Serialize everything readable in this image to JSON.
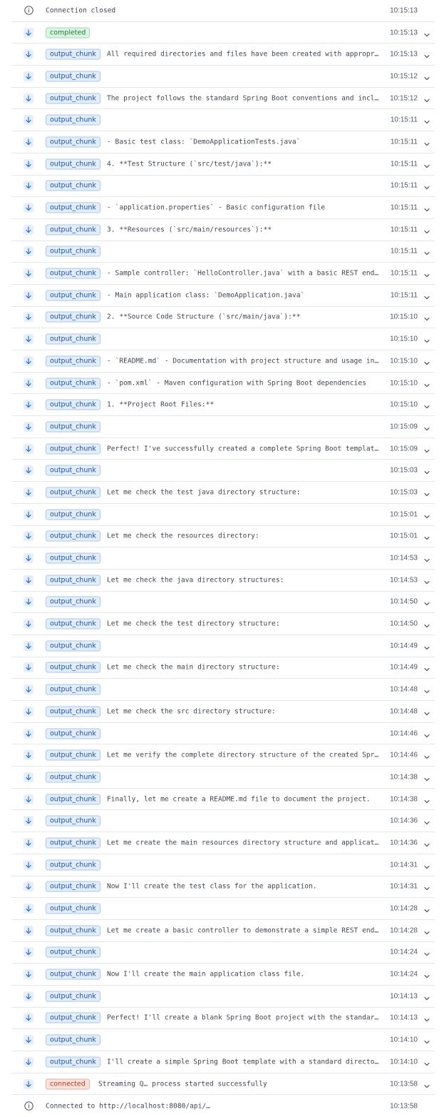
{
  "log": {
    "rows": [
      {
        "kind": "info",
        "badge": "",
        "badge_color": "",
        "message": "Connection closed",
        "time": "10:15:13",
        "expandable": false
      },
      {
        "kind": "event",
        "badge": "completed",
        "badge_color": "green",
        "message": "",
        "time": "10:15:13",
        "expandable": true
      },
      {
        "kind": "event",
        "badge": "output_chunk",
        "badge_color": "blue",
        "message": "All required directories and files have been created with appropriate …",
        "time": "10:15:13",
        "expandable": true
      },
      {
        "kind": "event",
        "badge": "output_chunk",
        "badge_color": "blue",
        "message": "",
        "time": "10:15:12",
        "expandable": true
      },
      {
        "kind": "event",
        "badge": "output_chunk",
        "badge_color": "blue",
        "message": "The project follows the standard Spring Boot conventions and includes …",
        "time": "10:15:12",
        "expandable": true
      },
      {
        "kind": "event",
        "badge": "output_chunk",
        "badge_color": "blue",
        "message": "",
        "time": "10:15:11",
        "expandable": true
      },
      {
        "kind": "event",
        "badge": "output_chunk",
        "badge_color": "blue",
        "message": "- Basic test class: `DemoApplicationTests.java`",
        "time": "10:15:11",
        "expandable": true
      },
      {
        "kind": "event",
        "badge": "output_chunk",
        "badge_color": "blue",
        "message": "4. **Test Structure (`src/test/java`):**",
        "time": "10:15:11",
        "expandable": true
      },
      {
        "kind": "event",
        "badge": "output_chunk",
        "badge_color": "blue",
        "message": "",
        "time": "10:15:11",
        "expandable": true
      },
      {
        "kind": "event",
        "badge": "output_chunk",
        "badge_color": "blue",
        "message": "- `application.properties` - Basic configuration file",
        "time": "10:15:11",
        "expandable": true
      },
      {
        "kind": "event",
        "badge": "output_chunk",
        "badge_color": "blue",
        "message": "3. **Resources (`src/main/resources`):**",
        "time": "10:15:11",
        "expandable": true
      },
      {
        "kind": "event",
        "badge": "output_chunk",
        "badge_color": "blue",
        "message": "",
        "time": "10:15:11",
        "expandable": true
      },
      {
        "kind": "event",
        "badge": "output_chunk",
        "badge_color": "blue",
        "message": "- Sample controller: `HelloController.java` with a basic REST endpoint",
        "time": "10:15:11",
        "expandable": true
      },
      {
        "kind": "event",
        "badge": "output_chunk",
        "badge_color": "blue",
        "message": "- Main application class: `DemoApplication.java`",
        "time": "10:15:11",
        "expandable": true
      },
      {
        "kind": "event",
        "badge": "output_chunk",
        "badge_color": "blue",
        "message": "2. **Source Code Structure (`src/main/java`):**",
        "time": "10:15:10",
        "expandable": true
      },
      {
        "kind": "event",
        "badge": "output_chunk",
        "badge_color": "blue",
        "message": "",
        "time": "10:15:10",
        "expandable": true
      },
      {
        "kind": "event",
        "badge": "output_chunk",
        "badge_color": "blue",
        "message": "- `README.md` - Documentation with project structure and usage instruc…",
        "time": "10:15:10",
        "expandable": true
      },
      {
        "kind": "event",
        "badge": "output_chunk",
        "badge_color": "blue",
        "message": "- `pom.xml` - Maven configuration with Spring Boot dependencies",
        "time": "10:15:10",
        "expandable": true
      },
      {
        "kind": "event",
        "badge": "output_chunk",
        "badge_color": "blue",
        "message": "1. **Project Root Files:**",
        "time": "10:15:10",
        "expandable": true
      },
      {
        "kind": "event",
        "badge": "output_chunk",
        "badge_color": "blue",
        "message": "",
        "time": "10:15:09",
        "expandable": true
      },
      {
        "kind": "event",
        "badge": "output_chunk",
        "badge_color": "blue",
        "message": "Perfect! I've successfully created a complete Spring Boot template pr…",
        "time": "10:15:09",
        "expandable": true
      },
      {
        "kind": "event",
        "badge": "output_chunk",
        "badge_color": "blue",
        "message": "",
        "time": "10:15:03",
        "expandable": true
      },
      {
        "kind": "event",
        "badge": "output_chunk",
        "badge_color": "blue",
        "message": "Let me check the test java directory structure:",
        "time": "10:15:03",
        "expandable": true
      },
      {
        "kind": "event",
        "badge": "output_chunk",
        "badge_color": "blue",
        "message": "",
        "time": "10:15:01",
        "expandable": true
      },
      {
        "kind": "event",
        "badge": "output_chunk",
        "badge_color": "blue",
        "message": "Let me check the resources directory:",
        "time": "10:15:01",
        "expandable": true
      },
      {
        "kind": "event",
        "badge": "output_chunk",
        "badge_color": "blue",
        "message": "",
        "time": "10:14:53",
        "expandable": true
      },
      {
        "kind": "event",
        "badge": "output_chunk",
        "badge_color": "blue",
        "message": "Let me check the java directory structures:",
        "time": "10:14:53",
        "expandable": true
      },
      {
        "kind": "event",
        "badge": "output_chunk",
        "badge_color": "blue",
        "message": "",
        "time": "10:14:50",
        "expandable": true
      },
      {
        "kind": "event",
        "badge": "output_chunk",
        "badge_color": "blue",
        "message": "Let me check the test directory structure:",
        "time": "10:14:50",
        "expandable": true
      },
      {
        "kind": "event",
        "badge": "output_chunk",
        "badge_color": "blue",
        "message": "",
        "time": "10:14:49",
        "expandable": true
      },
      {
        "kind": "event",
        "badge": "output_chunk",
        "badge_color": "blue",
        "message": "Let me check the main directory structure:",
        "time": "10:14:49",
        "expandable": true
      },
      {
        "kind": "event",
        "badge": "output_chunk",
        "badge_color": "blue",
        "message": "",
        "time": "10:14:48",
        "expandable": true
      },
      {
        "kind": "event",
        "badge": "output_chunk",
        "badge_color": "blue",
        "message": "Let me check the src directory structure:",
        "time": "10:14:48",
        "expandable": true
      },
      {
        "kind": "event",
        "badge": "output_chunk",
        "badge_color": "blue",
        "message": "",
        "time": "10:14:46",
        "expandable": true
      },
      {
        "kind": "event",
        "badge": "output_chunk",
        "badge_color": "blue",
        "message": "Let me verify the complete directory structure of the created Spring …",
        "time": "10:14:46",
        "expandable": true
      },
      {
        "kind": "event",
        "badge": "output_chunk",
        "badge_color": "blue",
        "message": "",
        "time": "10:14:38",
        "expandable": true
      },
      {
        "kind": "event",
        "badge": "output_chunk",
        "badge_color": "blue",
        "message": "Finally, let me create a README.md file to document the project.",
        "time": "10:14:38",
        "expandable": true
      },
      {
        "kind": "event",
        "badge": "output_chunk",
        "badge_color": "blue",
        "message": "",
        "time": "10:14:36",
        "expandable": true
      },
      {
        "kind": "event",
        "badge": "output_chunk",
        "badge_color": "blue",
        "message": "Let me create the main resources directory structure and application …",
        "time": "10:14:36",
        "expandable": true
      },
      {
        "kind": "event",
        "badge": "output_chunk",
        "badge_color": "blue",
        "message": "",
        "time": "10:14:31",
        "expandable": true
      },
      {
        "kind": "event",
        "badge": "output_chunk",
        "badge_color": "blue",
        "message": "Now I'll create the test class for the application.",
        "time": "10:14:31",
        "expandable": true
      },
      {
        "kind": "event",
        "badge": "output_chunk",
        "badge_color": "blue",
        "message": "",
        "time": "10:14:28",
        "expandable": true
      },
      {
        "kind": "event",
        "badge": "output_chunk",
        "badge_color": "blue",
        "message": "Let me create a basic controller to demonstrate a simple REST endpoin…",
        "time": "10:14:28",
        "expandable": true
      },
      {
        "kind": "event",
        "badge": "output_chunk",
        "badge_color": "blue",
        "message": "",
        "time": "10:14:24",
        "expandable": true
      },
      {
        "kind": "event",
        "badge": "output_chunk",
        "badge_color": "blue",
        "message": "Now I'll create the main application class file.",
        "time": "10:14:24",
        "expandable": true
      },
      {
        "kind": "event",
        "badge": "output_chunk",
        "badge_color": "blue",
        "message": "",
        "time": "10:14:13",
        "expandable": true
      },
      {
        "kind": "event",
        "badge": "output_chunk",
        "badge_color": "blue",
        "message": "Perfect! I'll create a blank Spring Boot project with the standard dir…",
        "time": "10:14:13",
        "expandable": true
      },
      {
        "kind": "event",
        "badge": "output_chunk",
        "badge_color": "blue",
        "message": "",
        "time": "10:14:10",
        "expandable": true
      },
      {
        "kind": "event",
        "badge": "output_chunk",
        "badge_color": "blue",
        "message": "I'll create a simple Spring Boot template with a standard directory st…",
        "time": "10:14:10",
        "expandable": true
      },
      {
        "kind": "event",
        "badge": "connected",
        "badge_color": "red",
        "message": "Streaming Q… process started successfully",
        "time": "10:13:58",
        "expandable": true
      },
      {
        "kind": "info",
        "badge": "",
        "badge_color": "",
        "message": "Connected to http://localhost:8080/api/…",
        "time": "10:13:58",
        "expandable": false
      }
    ]
  },
  "colors": {
    "badge_blue": "#1e4fa3",
    "badge_green": "#1f7a3a",
    "badge_red": "#b4361c",
    "down_icon": "#2a6fd6",
    "divider": "#e5e7eb"
  },
  "icons": {
    "event": "arrow-down-icon",
    "info": "info-icon",
    "expand": "chevron-down-icon"
  }
}
